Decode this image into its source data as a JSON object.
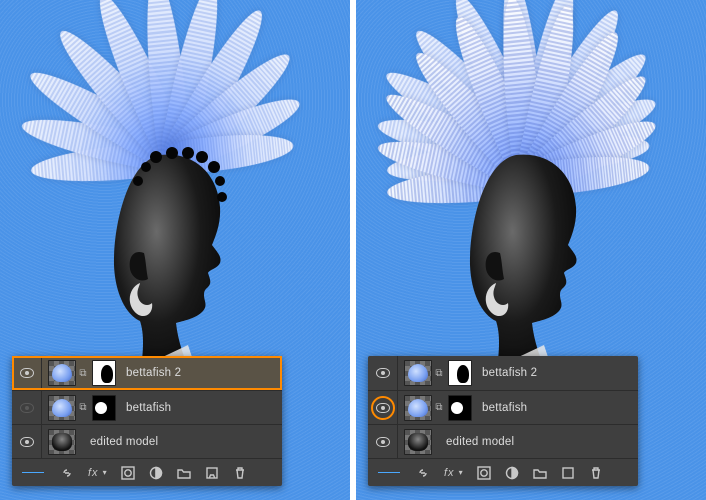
{
  "panel_left": {
    "layers": [
      {
        "name": "bettafish 2",
        "visible": true,
        "hasMask": true,
        "maskInverted": false,
        "selected": true,
        "thumb": "fish"
      },
      {
        "name": "bettafish",
        "visible": false,
        "hasMask": true,
        "maskInverted": true,
        "selected": false,
        "thumb": "fish"
      },
      {
        "name": "edited model",
        "visible": true,
        "hasMask": false,
        "maskInverted": false,
        "selected": false,
        "thumb": "model"
      }
    ],
    "highlight_visibility_index": null
  },
  "panel_right": {
    "layers": [
      {
        "name": "bettafish 2",
        "visible": true,
        "hasMask": true,
        "maskInverted": false,
        "selected": false,
        "thumb": "fish"
      },
      {
        "name": "bettafish",
        "visible": true,
        "hasMask": true,
        "maskInverted": true,
        "selected": false,
        "thumb": "fish"
      },
      {
        "name": "edited model",
        "visible": true,
        "hasMask": false,
        "maskInverted": false,
        "selected": false,
        "thumb": "model"
      }
    ],
    "highlight_visibility_index": 1
  },
  "bottombar": {
    "fx_label": "fx"
  },
  "colors": {
    "canvas_bg": "#4a93e8",
    "panel_bg": "#3f3f3f",
    "selection": "#ff8a00",
    "link_active": "#4aa8ff"
  }
}
